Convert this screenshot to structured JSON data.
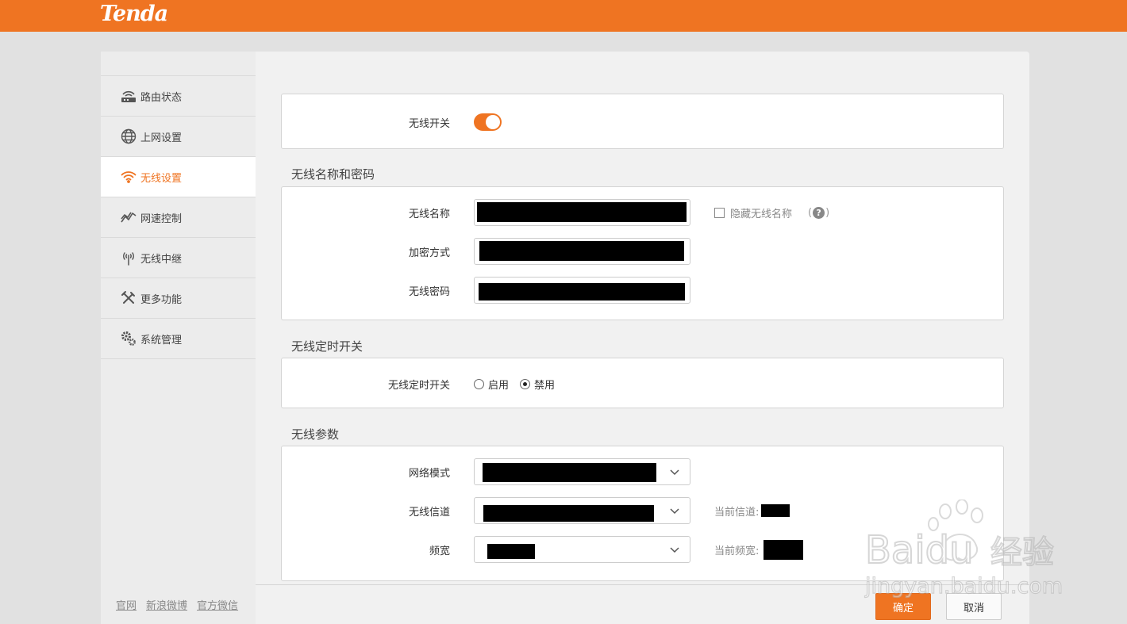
{
  "header": {
    "logo": "Tenda",
    "brand_color": "#ef7422"
  },
  "sidebar": {
    "items": [
      {
        "label": "路由状态",
        "icon": "router-icon",
        "active": false
      },
      {
        "label": "上网设置",
        "icon": "globe-icon",
        "active": false
      },
      {
        "label": "无线设置",
        "icon": "wifi-icon",
        "active": true
      },
      {
        "label": "网速控制",
        "icon": "speed-chart-icon",
        "active": false
      },
      {
        "label": "无线中继",
        "icon": "antenna-icon",
        "active": false
      },
      {
        "label": "更多功能",
        "icon": "tools-icon",
        "active": false
      },
      {
        "label": "系统管理",
        "icon": "gears-icon",
        "active": false
      }
    ],
    "footer_links": [
      "官网",
      "新浪微博",
      "官方微信"
    ]
  },
  "wireless_switch": {
    "label": "无线开关",
    "enabled": true
  },
  "ssid_section": {
    "title": "无线名称和密码",
    "ssid_label": "无线名称",
    "hide_ssid_label": "隐藏无线名称",
    "hide_ssid_checked": false,
    "help_text": "?",
    "encryption_label": "加密方式",
    "password_label": "无线密码"
  },
  "schedule_section": {
    "title": "无线定时开关",
    "label": "无线定时开关",
    "options": [
      "启用",
      "禁用"
    ],
    "selected": "禁用"
  },
  "params_section": {
    "title": "无线参数",
    "mode_label": "网络模式",
    "channel_label": "无线信道",
    "current_channel_label": "当前信道:",
    "bandwidth_label": "频宽",
    "current_bandwidth_label": "当前频宽:"
  },
  "actions": {
    "ok_label": "确定",
    "cancel_label": "取消"
  },
  "watermark": {
    "brand": "Baidu",
    "suffix": "经验",
    "url": "jingyan.baidu.com"
  }
}
